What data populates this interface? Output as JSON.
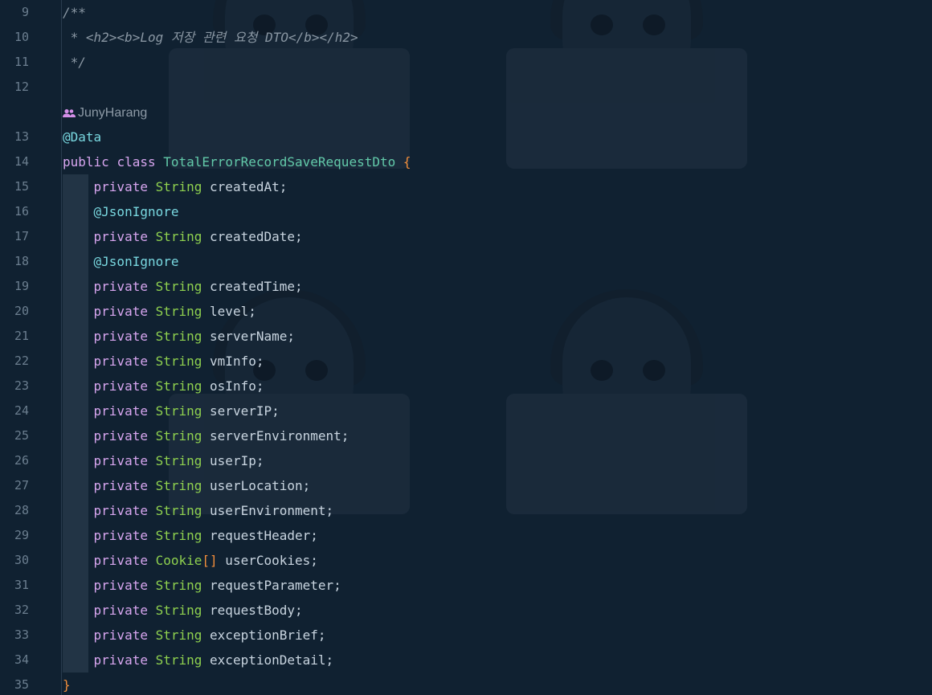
{
  "editor": {
    "author_hint": "JunyHarang",
    "lines": [
      {
        "n": "9",
        "parts": [
          {
            "t": "/**",
            "c": "comment"
          }
        ]
      },
      {
        "n": "10",
        "parts": [
          {
            "t": " * <h2><b>Log 저장 관련 요청 DTO</b></h2>",
            "c": "comment"
          }
        ]
      },
      {
        "n": "11",
        "parts": [
          {
            "t": " */",
            "c": "comment"
          }
        ]
      },
      {
        "n": "12",
        "parts": []
      },
      {
        "n": "",
        "author": true,
        "parts": []
      },
      {
        "n": "13",
        "parts": [
          {
            "t": "@Data",
            "c": "anno"
          }
        ]
      },
      {
        "n": "14",
        "parts": [
          {
            "t": "public",
            "c": "kw"
          },
          {
            "t": " ",
            "c": "punct"
          },
          {
            "t": "class",
            "c": "kw"
          },
          {
            "t": " ",
            "c": "punct"
          },
          {
            "t": "TotalErrorRecordSaveRequestDto",
            "c": "cls"
          },
          {
            "t": " ",
            "c": "punct"
          },
          {
            "t": "{",
            "c": "brace"
          }
        ]
      },
      {
        "n": "15",
        "parts": [
          {
            "t": "    ",
            "c": "punct"
          },
          {
            "t": "private",
            "c": "kw"
          },
          {
            "t": " ",
            "c": "punct"
          },
          {
            "t": "String",
            "c": "type"
          },
          {
            "t": " createdAt;",
            "c": "ident"
          }
        ]
      },
      {
        "n": "16",
        "parts": [
          {
            "t": "    ",
            "c": "punct"
          },
          {
            "t": "@JsonIgnore",
            "c": "anno"
          }
        ]
      },
      {
        "n": "17",
        "parts": [
          {
            "t": "    ",
            "c": "punct"
          },
          {
            "t": "private",
            "c": "kw"
          },
          {
            "t": " ",
            "c": "punct"
          },
          {
            "t": "String",
            "c": "type"
          },
          {
            "t": " createdDate;",
            "c": "ident"
          }
        ]
      },
      {
        "n": "18",
        "parts": [
          {
            "t": "    ",
            "c": "punct"
          },
          {
            "t": "@JsonIgnore",
            "c": "anno"
          }
        ]
      },
      {
        "n": "19",
        "parts": [
          {
            "t": "    ",
            "c": "punct"
          },
          {
            "t": "private",
            "c": "kw"
          },
          {
            "t": " ",
            "c": "punct"
          },
          {
            "t": "String",
            "c": "type"
          },
          {
            "t": " createdTime;",
            "c": "ident"
          }
        ]
      },
      {
        "n": "20",
        "parts": [
          {
            "t": "    ",
            "c": "punct"
          },
          {
            "t": "private",
            "c": "kw"
          },
          {
            "t": " ",
            "c": "punct"
          },
          {
            "t": "String",
            "c": "type"
          },
          {
            "t": " level;",
            "c": "ident"
          }
        ]
      },
      {
        "n": "21",
        "parts": [
          {
            "t": "    ",
            "c": "punct"
          },
          {
            "t": "private",
            "c": "kw"
          },
          {
            "t": " ",
            "c": "punct"
          },
          {
            "t": "String",
            "c": "type"
          },
          {
            "t": " serverName;",
            "c": "ident"
          }
        ]
      },
      {
        "n": "22",
        "parts": [
          {
            "t": "    ",
            "c": "punct"
          },
          {
            "t": "private",
            "c": "kw"
          },
          {
            "t": " ",
            "c": "punct"
          },
          {
            "t": "String",
            "c": "type"
          },
          {
            "t": " vmInfo;",
            "c": "ident"
          }
        ]
      },
      {
        "n": "23",
        "parts": [
          {
            "t": "    ",
            "c": "punct"
          },
          {
            "t": "private",
            "c": "kw"
          },
          {
            "t": " ",
            "c": "punct"
          },
          {
            "t": "String",
            "c": "type"
          },
          {
            "t": " osInfo;",
            "c": "ident"
          }
        ]
      },
      {
        "n": "24",
        "parts": [
          {
            "t": "    ",
            "c": "punct"
          },
          {
            "t": "private",
            "c": "kw"
          },
          {
            "t": " ",
            "c": "punct"
          },
          {
            "t": "String",
            "c": "type"
          },
          {
            "t": " serverIP;",
            "c": "ident"
          }
        ]
      },
      {
        "n": "25",
        "parts": [
          {
            "t": "    ",
            "c": "punct"
          },
          {
            "t": "private",
            "c": "kw"
          },
          {
            "t": " ",
            "c": "punct"
          },
          {
            "t": "String",
            "c": "type"
          },
          {
            "t": " serverEnvironment;",
            "c": "ident"
          }
        ]
      },
      {
        "n": "26",
        "parts": [
          {
            "t": "    ",
            "c": "punct"
          },
          {
            "t": "private",
            "c": "kw"
          },
          {
            "t": " ",
            "c": "punct"
          },
          {
            "t": "String",
            "c": "type"
          },
          {
            "t": " userIp;",
            "c": "ident"
          }
        ]
      },
      {
        "n": "27",
        "parts": [
          {
            "t": "    ",
            "c": "punct"
          },
          {
            "t": "private",
            "c": "kw"
          },
          {
            "t": " ",
            "c": "punct"
          },
          {
            "t": "String",
            "c": "type"
          },
          {
            "t": " userLocation;",
            "c": "ident"
          }
        ]
      },
      {
        "n": "28",
        "parts": [
          {
            "t": "    ",
            "c": "punct"
          },
          {
            "t": "private",
            "c": "kw"
          },
          {
            "t": " ",
            "c": "punct"
          },
          {
            "t": "String",
            "c": "type"
          },
          {
            "t": " userEnvironment;",
            "c": "ident"
          }
        ]
      },
      {
        "n": "29",
        "parts": [
          {
            "t": "    ",
            "c": "punct"
          },
          {
            "t": "private",
            "c": "kw"
          },
          {
            "t": " ",
            "c": "punct"
          },
          {
            "t": "String",
            "c": "type"
          },
          {
            "t": " requestHeader;",
            "c": "ident"
          }
        ]
      },
      {
        "n": "30",
        "parts": [
          {
            "t": "    ",
            "c": "punct"
          },
          {
            "t": "private",
            "c": "kw"
          },
          {
            "t": " ",
            "c": "punct"
          },
          {
            "t": "Cookie",
            "c": "type"
          },
          {
            "t": "[]",
            "c": "brace"
          },
          {
            "t": " userCookies;",
            "c": "ident"
          }
        ]
      },
      {
        "n": "31",
        "parts": [
          {
            "t": "    ",
            "c": "punct"
          },
          {
            "t": "private",
            "c": "kw"
          },
          {
            "t": " ",
            "c": "punct"
          },
          {
            "t": "String",
            "c": "type"
          },
          {
            "t": " requestParameter;",
            "c": "ident"
          }
        ]
      },
      {
        "n": "32",
        "parts": [
          {
            "t": "    ",
            "c": "punct"
          },
          {
            "t": "private",
            "c": "kw"
          },
          {
            "t": " ",
            "c": "punct"
          },
          {
            "t": "String",
            "c": "type"
          },
          {
            "t": " requestBody;",
            "c": "ident"
          }
        ]
      },
      {
        "n": "33",
        "parts": [
          {
            "t": "    ",
            "c": "punct"
          },
          {
            "t": "private",
            "c": "kw"
          },
          {
            "t": " ",
            "c": "punct"
          },
          {
            "t": "String",
            "c": "type"
          },
          {
            "t": " exceptionBrief;",
            "c": "ident"
          }
        ]
      },
      {
        "n": "34",
        "parts": [
          {
            "t": "    ",
            "c": "punct"
          },
          {
            "t": "private",
            "c": "kw"
          },
          {
            "t": " ",
            "c": "punct"
          },
          {
            "t": "String",
            "c": "type"
          },
          {
            "t": " exceptionDetail;",
            "c": "ident"
          }
        ]
      },
      {
        "n": "35",
        "parts": [
          {
            "t": "}",
            "c": "brace"
          }
        ]
      }
    ]
  },
  "colors": {
    "background": "#102131",
    "keyword": "#d8a6f0",
    "annotation": "#79d8e0",
    "type": "#8fd14f",
    "class_name": "#62c9a9",
    "brace": "#f08d3b",
    "comment": "#8a97a3",
    "line_number": "#6b7e8f"
  }
}
